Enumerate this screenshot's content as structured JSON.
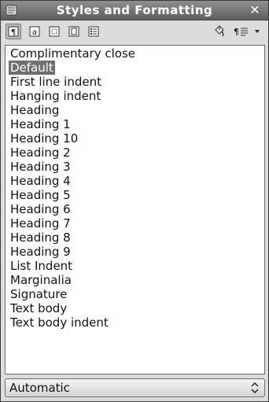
{
  "window": {
    "title": "Styles and Formatting"
  },
  "toolbar": {
    "buttons": [
      {
        "icon": "paragraph-styles-icon",
        "active": true
      },
      {
        "icon": "character-styles-icon",
        "active": false
      },
      {
        "icon": "frame-styles-icon",
        "active": false
      },
      {
        "icon": "page-styles-icon",
        "active": false
      },
      {
        "icon": "list-styles-icon",
        "active": false
      }
    ],
    "right_icons": [
      "fill-format-mode-icon",
      "new-style-from-selection-icon",
      "dropdown-arrow-icon"
    ]
  },
  "styles_list": {
    "items": [
      "Complimentary close",
      "Default",
      "First line indent",
      "Hanging indent",
      "Heading",
      "Heading 1",
      "Heading 10",
      "Heading 2",
      "Heading 3",
      "Heading 4",
      "Heading 5",
      "Heading 6",
      "Heading 7",
      "Heading 8",
      "Heading 9",
      "List Indent",
      "Marginalia",
      "Signature",
      "Text body",
      "Text body indent"
    ],
    "selected": "Default"
  },
  "filter": {
    "value": "Automatic"
  }
}
